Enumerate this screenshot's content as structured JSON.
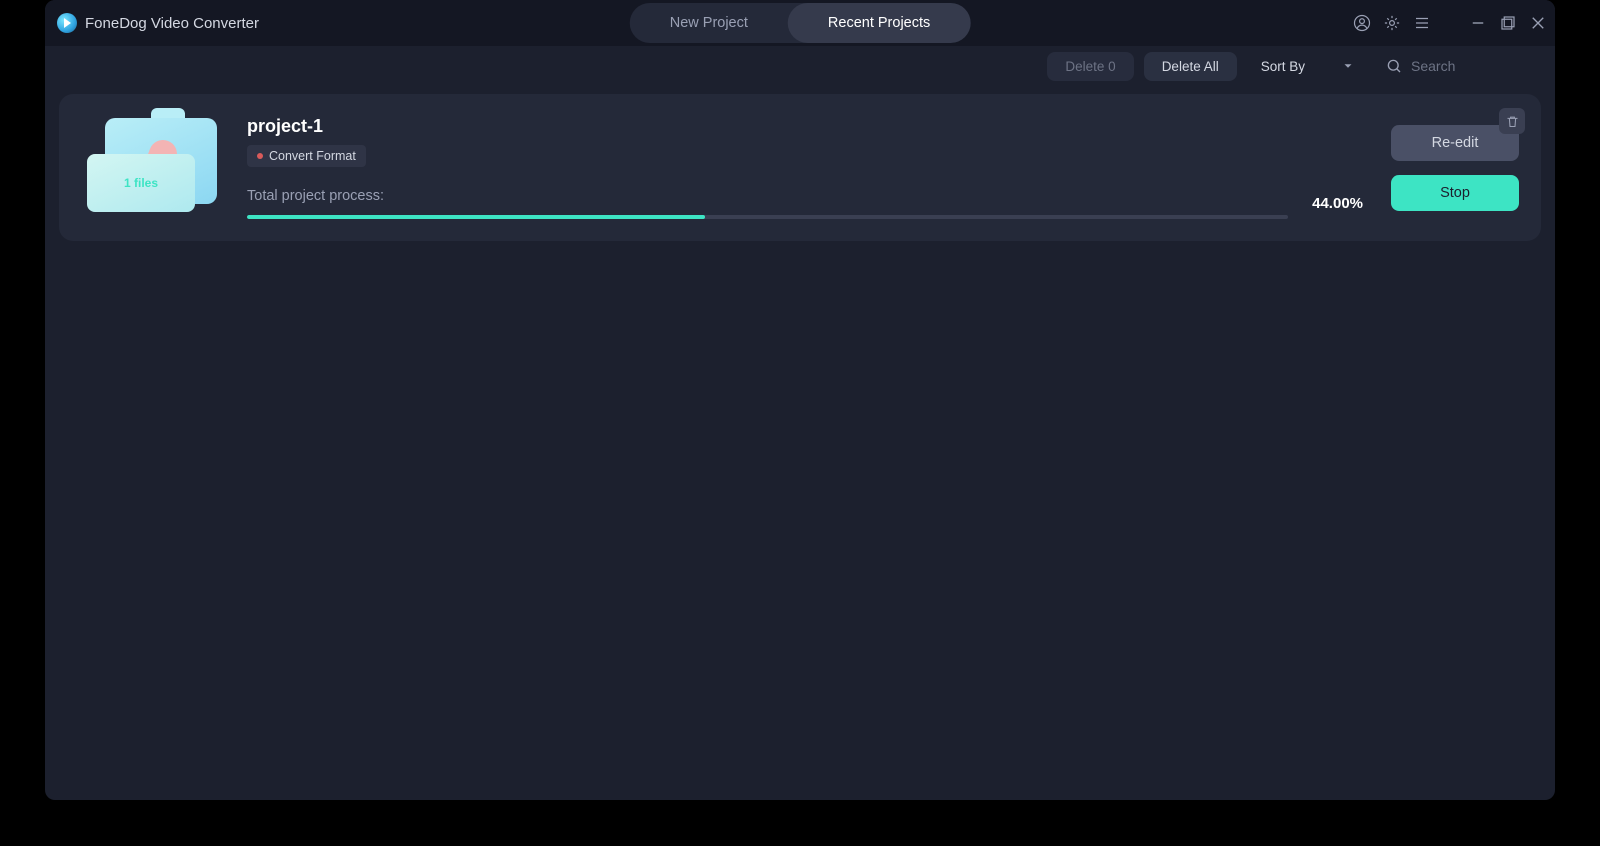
{
  "app": {
    "title": "FoneDog Video Converter"
  },
  "tabs": {
    "new_project": "New Project",
    "recent_projects": "Recent Projects",
    "active": "recent_projects"
  },
  "toolbar": {
    "delete_count_label": "Delete 0",
    "delete_all_label": "Delete All",
    "sort_by_label": "Sort By",
    "search_placeholder": "Search"
  },
  "project": {
    "name": "project-1",
    "file_badge": "1 files",
    "tag": "Convert Format",
    "progress_label": "Total project process:",
    "progress_pct_text": "44.00%",
    "progress_pct_value": 44,
    "reedit_label": "Re-edit",
    "stop_label": "Stop"
  },
  "icons": {
    "user": "user-icon",
    "settings": "gear-icon",
    "menu": "menu-icon",
    "minimize": "minimize-icon",
    "maximize": "maximize-icon",
    "close": "close-icon",
    "chevron_down": "chevron-down-icon",
    "search": "search-icon",
    "trash": "trash-icon"
  }
}
